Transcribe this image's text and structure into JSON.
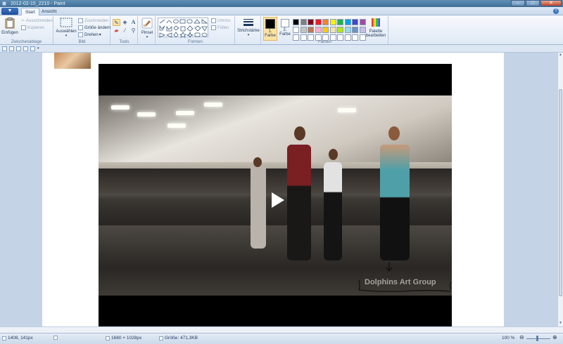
{
  "window": {
    "title": "2012-02-15_2210 - Paint",
    "buttons": [
      "–",
      "□",
      "✕"
    ]
  },
  "tabs": {
    "file": "▼",
    "items": [
      "Start",
      "Ansicht"
    ],
    "help": "?"
  },
  "ribbon": {
    "clipboard": {
      "label": "Zwischenablage",
      "paste": "Einfügen",
      "cut": "Ausschneiden",
      "copy": "Kopieren"
    },
    "image": {
      "label": "Bild",
      "select": "Auswählen",
      "crop": "Zuschneiden",
      "resize": "Größe ändern",
      "rotate": "Drehen"
    },
    "tools": {
      "label": "Tools",
      "icons": [
        "pencil-icon",
        "fill-icon",
        "text-icon",
        "eraser-icon",
        "color-picker-icon",
        "magnifier-icon"
      ]
    },
    "brushes": {
      "label": "Pinsel"
    },
    "shapes": {
      "label": "Formen",
      "outline": "Umriss",
      "fill": "Füllen"
    },
    "size": {
      "label": "Strichstärke"
    },
    "colors": {
      "label": "Farben",
      "color1": "1. Farbe",
      "color2": "2. Farbe",
      "edit": "Palette bearbeiten",
      "palette_row1": [
        "#000000",
        "#7f7f7f",
        "#880015",
        "#ed1c24",
        "#ff7f27",
        "#fff200",
        "#22b14c",
        "#00a2e8",
        "#3f48cc",
        "#a349a4"
      ],
      "palette_row2": [
        "#ffffff",
        "#c3c3c3",
        "#b97a57",
        "#ffaec9",
        "#ffc90e",
        "#efe4b0",
        "#b5e61d",
        "#99d9ea",
        "#7092be",
        "#c8bfe7"
      ],
      "palette_row3": [
        "#ffffff",
        "#ffffff",
        "#ffffff",
        "#ffffff",
        "#ffffff",
        "#ffffff",
        "#ffffff",
        "#ffffff",
        "#ffffff",
        "#ffffff"
      ]
    }
  },
  "canvas": {
    "video": {
      "watermark": "Dolphins Art Group"
    }
  },
  "status": {
    "cursor": "1408, 141px",
    "dimensions": "1680 × 1028px",
    "filesize": "Größe: 471,3KB",
    "zoom": "100 %"
  }
}
